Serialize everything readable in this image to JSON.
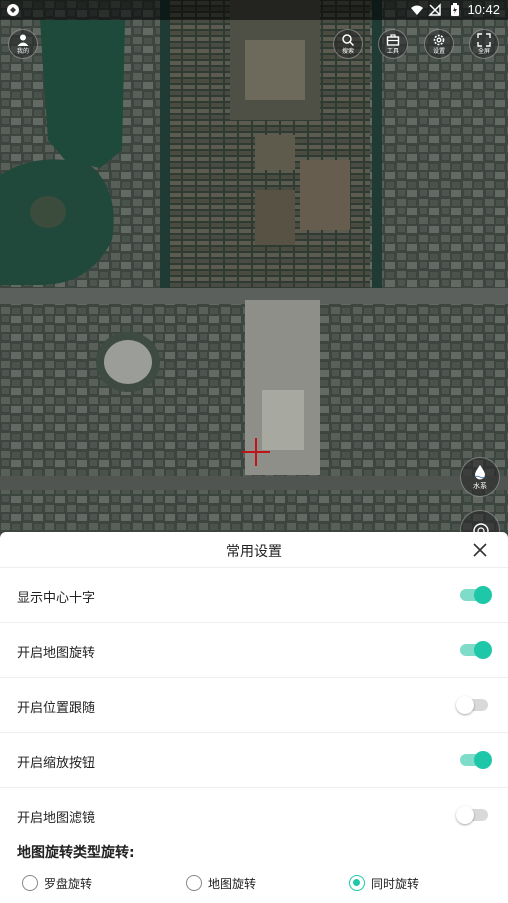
{
  "status_bar": {
    "time": "10:42"
  },
  "map_controls": {
    "profile": {
      "label": "我的",
      "icon": "user-icon"
    },
    "search": {
      "label": "搜索",
      "icon": "search-icon"
    },
    "tools": {
      "label": "工具",
      "icon": "toolbox-icon"
    },
    "settings": {
      "label": "设置",
      "icon": "gear-icon"
    },
    "fullscreen": {
      "label": "全屏",
      "icon": "expand-icon"
    },
    "water": {
      "label": "水系",
      "icon": "water-drop-icon"
    }
  },
  "sheet": {
    "title": "常用设置",
    "settings": [
      {
        "label": "显示中心十字",
        "enabled": true
      },
      {
        "label": "开启地图旋转",
        "enabled": true
      },
      {
        "label": "开启位置跟随",
        "enabled": false
      },
      {
        "label": "开启缩放按钮",
        "enabled": true
      },
      {
        "label": "开启地图滤镜",
        "enabled": false
      }
    ],
    "rotation_section_title": "地图旋转类型旋转:",
    "rotation_options": [
      {
        "label": "罗盘旋转",
        "checked": false
      },
      {
        "label": "地图旋转",
        "checked": false
      },
      {
        "label": "同时旋转",
        "checked": true
      }
    ]
  },
  "colors": {
    "accent": "#1ec7a8",
    "accent_light": "#7fdcc9",
    "crosshair": "#c0141a"
  }
}
